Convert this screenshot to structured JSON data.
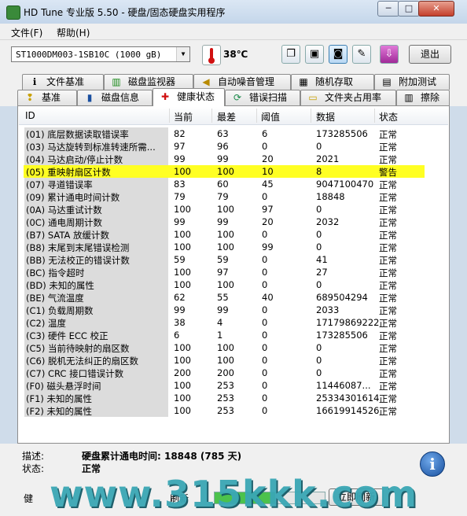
{
  "window": {
    "title": "HD Tune 专业版 5.50 - 硬盘/固态硬盘实用程序",
    "min": "─",
    "max": "□",
    "close": "✕"
  },
  "menu": [
    "文件(F)",
    "帮助(H)"
  ],
  "toolbar": {
    "drive": "ST1000DM003-1SB10C (1000 gB)",
    "temperature": "38℃",
    "exit_label": "退出",
    "buttons": [
      "copy-info-icon",
      "copy-screen-icon",
      "camera-icon",
      "tools-icon",
      "download-icon"
    ]
  },
  "tabs_top": [
    {
      "label": "文件基准",
      "icon": "file-benchmark-icon",
      "glyph": "ℹ"
    },
    {
      "label": "磁盘监视器",
      "icon": "disk-monitor-icon",
      "glyph": "▥"
    },
    {
      "label": "自动噪音管理",
      "icon": "speaker-icon",
      "glyph": "◀"
    },
    {
      "label": "随机存取",
      "icon": "random-access-icon",
      "glyph": "▦"
    },
    {
      "label": "附加测试",
      "icon": "extra-tests-icon",
      "glyph": "▤"
    }
  ],
  "tabs_bottom": [
    {
      "label": "基准",
      "icon": "benchmark-icon",
      "glyph": "❢"
    },
    {
      "label": "磁盘信息",
      "icon": "disk-info-icon",
      "glyph": "▮"
    },
    {
      "label": "健康状态",
      "icon": "health-cross-icon",
      "glyph": "✚"
    },
    {
      "label": "错误扫描",
      "icon": "error-scan-icon",
      "glyph": "⟳"
    },
    {
      "label": "文件夹占用率",
      "icon": "folder-icon",
      "glyph": "▭"
    },
    {
      "label": "擦除",
      "icon": "trash-icon",
      "glyph": "▥"
    }
  ],
  "grid": {
    "headers": [
      "ID",
      "当前",
      "最差",
      "阈值",
      "数据",
      "状态"
    ],
    "rows": [
      {
        "id": "(01) 底层数据读取错误率",
        "cur": "82",
        "worst": "63",
        "thr": "6",
        "data": "173285506",
        "status": "正常"
      },
      {
        "id": "(03) 马达旋转到标准转速所需...",
        "cur": "97",
        "worst": "96",
        "thr": "0",
        "data": "0",
        "status": "正常"
      },
      {
        "id": "(04) 马达启动/停止计数",
        "cur": "99",
        "worst": "99",
        "thr": "20",
        "data": "2021",
        "status": "正常"
      },
      {
        "id": "(05) 重映射扇区计数",
        "cur": "100",
        "worst": "100",
        "thr": "10",
        "data": "8",
        "status": "警告",
        "warn": true
      },
      {
        "id": "(07) 寻道错误率",
        "cur": "83",
        "worst": "60",
        "thr": "45",
        "data": "9047100470",
        "status": "正常"
      },
      {
        "id": "(09) 累计通电时间计数",
        "cur": "79",
        "worst": "79",
        "thr": "0",
        "data": "18848",
        "status": "正常"
      },
      {
        "id": "(0A) 马达重试计数",
        "cur": "100",
        "worst": "100",
        "thr": "97",
        "data": "0",
        "status": "正常"
      },
      {
        "id": "(0C) 通电周期计数",
        "cur": "99",
        "worst": "99",
        "thr": "20",
        "data": "2032",
        "status": "正常"
      },
      {
        "id": "(B7) SATA 放缓计数",
        "cur": "100",
        "worst": "100",
        "thr": "0",
        "data": "0",
        "status": "正常"
      },
      {
        "id": "(B8) 末尾到末尾错误检测",
        "cur": "100",
        "worst": "100",
        "thr": "99",
        "data": "0",
        "status": "正常"
      },
      {
        "id": "(BB) 无法校正的错误计数",
        "cur": "59",
        "worst": "59",
        "thr": "0",
        "data": "41",
        "status": "正常"
      },
      {
        "id": "(BC) 指令超时",
        "cur": "100",
        "worst": "97",
        "thr": "0",
        "data": "27",
        "status": "正常"
      },
      {
        "id": "(BD) 未知的属性",
        "cur": "100",
        "worst": "100",
        "thr": "0",
        "data": "0",
        "status": "正常"
      },
      {
        "id": "(BE) 气流温度",
        "cur": "62",
        "worst": "55",
        "thr": "40",
        "data": "689504294",
        "status": "正常"
      },
      {
        "id": "(C1) 负载周期数",
        "cur": "99",
        "worst": "99",
        "thr": "0",
        "data": "2033",
        "status": "正常"
      },
      {
        "id": "(C2) 温度",
        "cur": "38",
        "worst": "4",
        "thr": "0",
        "data": "17179869222",
        "status": "正常"
      },
      {
        "id": "(C3) 硬件 ECC 校正",
        "cur": "6",
        "worst": "1",
        "thr": "0",
        "data": "173285506",
        "status": "正常"
      },
      {
        "id": "(C5) 当前待映射的扇区数",
        "cur": "100",
        "worst": "100",
        "thr": "0",
        "data": "0",
        "status": "正常"
      },
      {
        "id": "(C6) 脱机无法纠正的扇区数",
        "cur": "100",
        "worst": "100",
        "thr": "0",
        "data": "0",
        "status": "正常"
      },
      {
        "id": "(C7) CRC 接口错误计数",
        "cur": "200",
        "worst": "200",
        "thr": "0",
        "data": "0",
        "status": "正常"
      },
      {
        "id": "(F0) 磁头悬浮时间",
        "cur": "100",
        "worst": "253",
        "thr": "0",
        "data": "11446087...",
        "status": "正常"
      },
      {
        "id": "(F1) 未知的属性",
        "cur": "100",
        "worst": "253",
        "thr": "0",
        "data": "25334301614",
        "status": "正常"
      },
      {
        "id": "(F2) 未知的属性",
        "cur": "100",
        "worst": "253",
        "thr": "0",
        "data": "16619914526",
        "status": "正常"
      }
    ]
  },
  "details": {
    "desc_label": "描述:",
    "desc_value": "硬盘累计通电时间: 18848 (785 天)",
    "status_label": "状态:",
    "status_value": "正常",
    "info_glyph": "i"
  },
  "bottom": {
    "log_label": "健",
    "refresh_label": "刷新",
    "refresh_button": "立即刷新",
    "progress": 0.55
  },
  "watermark": "www.315kkk.com",
  "colors": {
    "warning_row": "#ffff23",
    "id_column": "#dcdcdc",
    "watermark": "#3aa7b5"
  }
}
